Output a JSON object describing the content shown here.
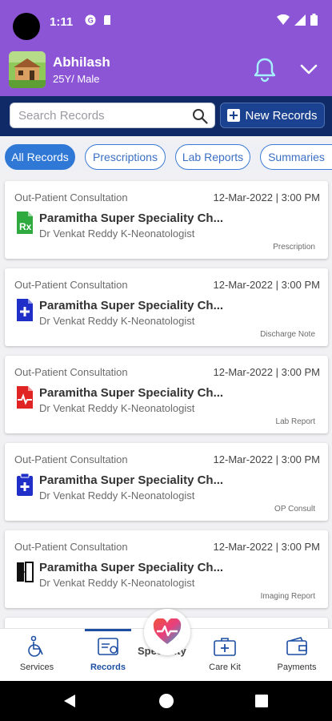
{
  "status_bar": {
    "time": "1:11",
    "icons": [
      "google-icon",
      "sd-card-icon",
      "wifi-icon",
      "signal-icon",
      "battery-icon"
    ]
  },
  "header": {
    "user_name": "Abhilash",
    "user_meta": "25Y/ Male",
    "icons": [
      "avatar",
      "bell-icon",
      "chevron-down-icon"
    ]
  },
  "search": {
    "placeholder": "Search Records",
    "new_button_label": "New Records"
  },
  "filters": [
    {
      "label": "All Records",
      "active": true
    },
    {
      "label": "Prescriptions",
      "active": false
    },
    {
      "label": "Lab Reports",
      "active": false
    },
    {
      "label": "Summaries",
      "active": false
    }
  ],
  "records": [
    {
      "type": "Out-Patient Consultation",
      "date": "12-Mar-2022 | 3:00 PM",
      "hospital": "Paramitha Super Speciality Ch...",
      "doctor": "Dr Venkat Reddy K-Neonatologist",
      "kind": "Prescription",
      "icon": "prescription-icon"
    },
    {
      "type": "Out-Patient Consultation",
      "date": "12-Mar-2022 | 3:00 PM",
      "hospital": "Paramitha Super Speciality Ch...",
      "doctor": "Dr Venkat Reddy K-Neonatologist",
      "kind": "Discharge Note",
      "icon": "discharge-note-icon"
    },
    {
      "type": "Out-Patient Consultation",
      "date": "12-Mar-2022 | 3:00 PM",
      "hospital": "Paramitha Super Speciality Ch...",
      "doctor": "Dr Venkat Reddy K-Neonatologist",
      "kind": "Lab Report",
      "icon": "lab-report-icon"
    },
    {
      "type": "Out-Patient Consultation",
      "date": "12-Mar-2022 | 3:00 PM",
      "hospital": "Paramitha Super Speciality Ch...",
      "doctor": "Dr Venkat Reddy K-Neonatologist",
      "kind": "OP Consult",
      "icon": "op-consult-icon"
    },
    {
      "type": "Out-Patient Consultation",
      "date": "12-Mar-2022 | 3:00 PM",
      "hospital": "Paramitha Super Speciality Ch...",
      "doctor": "Dr Venkat Reddy K-Neonatologist",
      "kind": "Imaging Report",
      "icon": "imaging-report-icon"
    }
  ],
  "peek_text": "Speciality",
  "bottom_nav": [
    {
      "label": "Services",
      "icon": "wheelchair-icon",
      "active": false
    },
    {
      "label": "Records",
      "icon": "records-icon",
      "active": true
    },
    {
      "label": "Care Kit",
      "icon": "care-kit-icon",
      "active": false
    },
    {
      "label": "Payments",
      "icon": "wallet-icon",
      "active": false
    }
  ],
  "colors": {
    "header_purple": "#8c55d6",
    "search_band_navy": "#0f2a66",
    "accent_blue": "#2f78d6"
  }
}
